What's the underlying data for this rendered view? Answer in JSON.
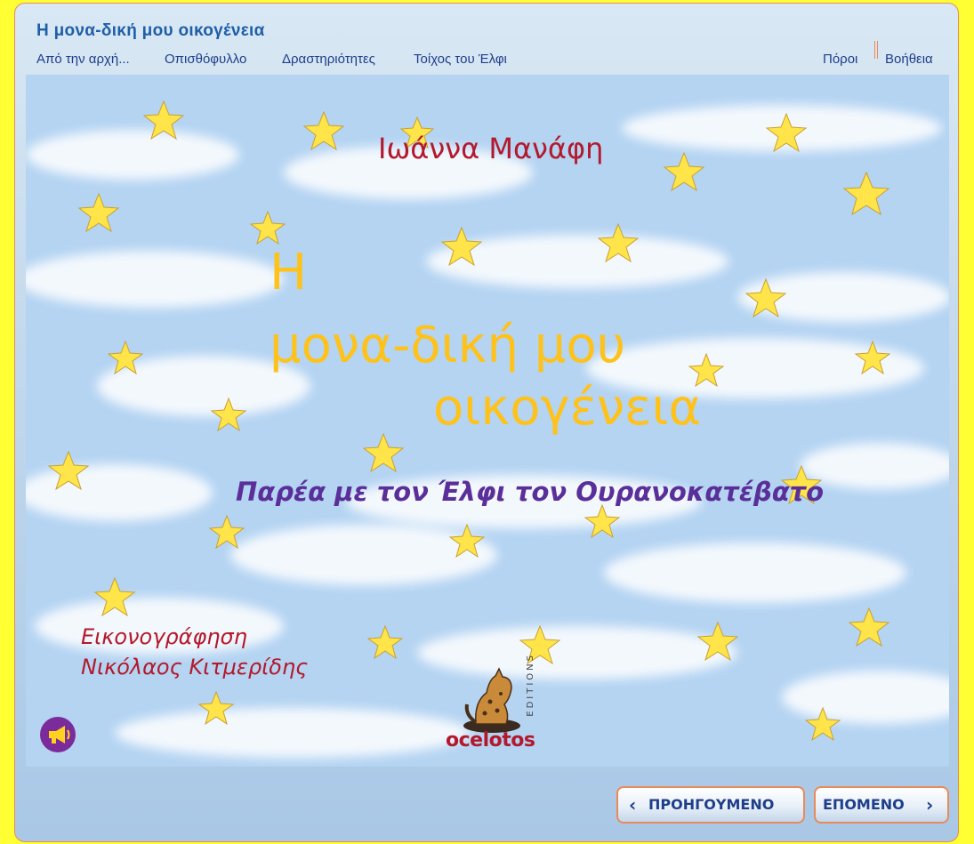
{
  "header": {
    "book_title": "Η μονα-δική μου οικογένεια",
    "nav": {
      "start": "Από την αρχή...",
      "back_cover": "Οπισθόφυλλο",
      "activities": "Δραστηριότητες",
      "wall": "Τοίχος του Έλφι",
      "resources": "Πόροι",
      "help": "Βοήθεια"
    }
  },
  "cover": {
    "author": "Ιωάννα Μανάφη",
    "title_line1": "Η",
    "title_line2": "μονα-δική μου",
    "title_line3": "οικογένεια",
    "subtitle": "Παρέα με τον Έλφι τον Ουρανοκατέβατο",
    "illustration_label": "Εικονογράφηση",
    "illustrator": "Νικόλαος Κιτμερίδης",
    "publisher": "ocelotos",
    "publisher_editions": "EDITIONS",
    "audio_icon": "megaphone-icon"
  },
  "footer": {
    "prev_label": "ΠΡΟΗΓΟΥΜΕΝΟ",
    "next_label": "ΕΠΟΜΕΝΟ",
    "prev_icon": "chevron-left-icon",
    "next_icon": "chevron-right-icon"
  },
  "colors": {
    "page_background": "#ffff33",
    "accent_border": "#e98a5a",
    "nav_text": "#1f3e8a",
    "title_yellow": "#ffc21a",
    "author_red": "#b3192c",
    "subtitle_purple": "#5a2f9a"
  }
}
